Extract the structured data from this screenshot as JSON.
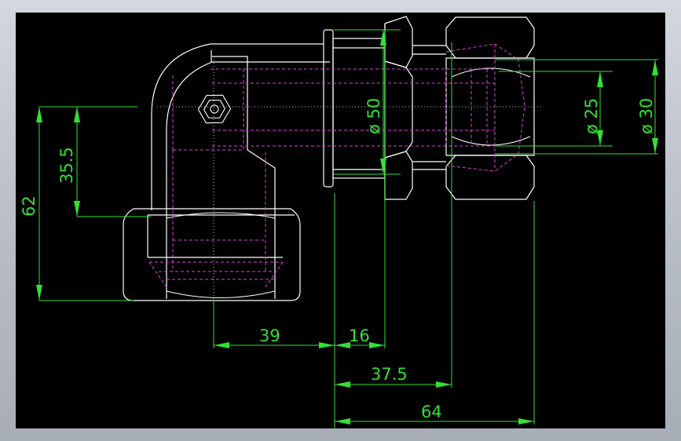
{
  "drawing": {
    "colors": {
      "background": "#000000",
      "part_outline": "#ffffff",
      "hidden_lines": "#e040e0",
      "dimensions": "#33e033",
      "frame": "#b9bec7"
    },
    "dimensions": {
      "d39": "39",
      "d16": "16",
      "d37_5": "37.5",
      "d64": "64",
      "d62": "62",
      "d35_5": "35.5",
      "dia50": "ø 50",
      "dia25": "ø 25",
      "dia30": "ø 30"
    }
  }
}
